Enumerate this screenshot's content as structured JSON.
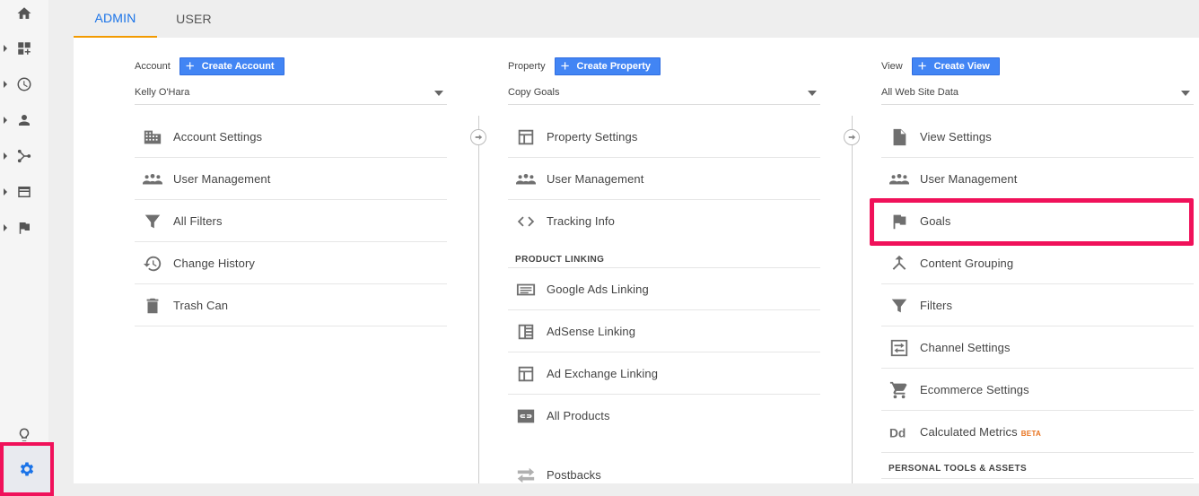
{
  "tabs": [
    {
      "label": "ADMIN",
      "active": true
    },
    {
      "label": "USER",
      "active": false
    }
  ],
  "accent_color": "#1a73e8",
  "highlight_color": "#f0115a",
  "columns": {
    "account": {
      "label": "Account",
      "create_label": "Create Account",
      "selected": "Kelly O'Hara",
      "items": [
        {
          "label": "Account Settings",
          "icon": "building-icon"
        },
        {
          "label": "User Management",
          "icon": "people-icon"
        },
        {
          "label": "All Filters",
          "icon": "filter-icon"
        },
        {
          "label": "Change History",
          "icon": "history-icon"
        },
        {
          "label": "Trash Can",
          "icon": "trash-icon"
        }
      ]
    },
    "property": {
      "label": "Property",
      "create_label": "Create Property",
      "selected": "Copy Goals",
      "items": [
        {
          "label": "Property Settings",
          "icon": "layout-icon"
        },
        {
          "label": "User Management",
          "icon": "people-icon"
        },
        {
          "label": "Tracking Info",
          "icon": "code-icon"
        }
      ],
      "section": "PRODUCT LINKING",
      "linking": [
        {
          "label": "Google Ads Linking",
          "icon": "ads-icon"
        },
        {
          "label": "AdSense Linking",
          "icon": "adsense-icon"
        },
        {
          "label": "Ad Exchange Linking",
          "icon": "layout-icon"
        },
        {
          "label": "All Products",
          "icon": "link-icon"
        },
        {
          "label": "Postbacks",
          "icon": "postback-icon"
        }
      ]
    },
    "view": {
      "label": "View",
      "create_label": "Create View",
      "selected": "All Web Site Data",
      "items": [
        {
          "label": "View Settings",
          "icon": "document-icon"
        },
        {
          "label": "User Management",
          "icon": "people-icon"
        },
        {
          "label": "Goals",
          "icon": "flag-icon"
        },
        {
          "label": "Content Grouping",
          "icon": "grouping-icon"
        },
        {
          "label": "Filters",
          "icon": "filter-icon"
        },
        {
          "label": "Channel Settings",
          "icon": "channel-icon"
        },
        {
          "label": "Ecommerce Settings",
          "icon": "cart-icon"
        },
        {
          "label": "Calculated Metrics",
          "icon": "dd-icon",
          "badge": "BETA"
        }
      ],
      "section": "PERSONAL TOOLS & ASSETS"
    }
  }
}
